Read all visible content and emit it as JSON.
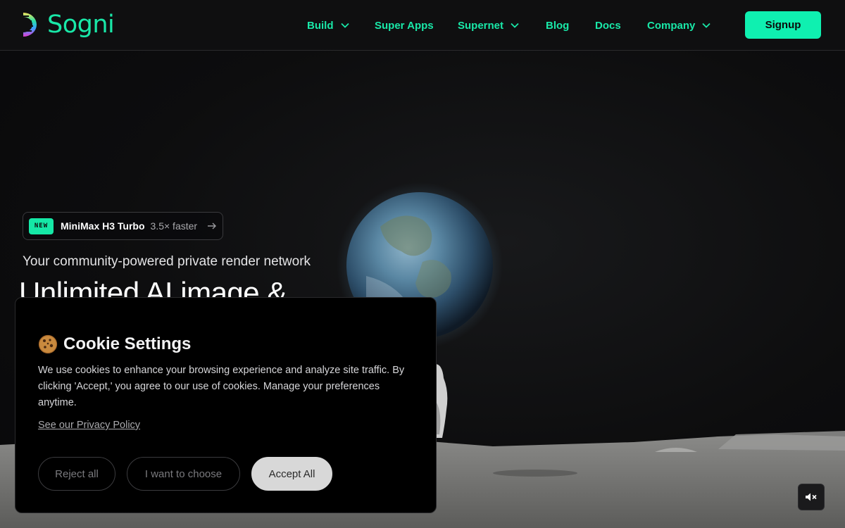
{
  "brand": {
    "name": "Sogni",
    "accent": "#19e8a8"
  },
  "nav": {
    "items": [
      {
        "label": "Build",
        "has_dropdown": true
      },
      {
        "label": "Super Apps",
        "has_dropdown": false
      },
      {
        "label": "Supernet",
        "has_dropdown": true
      },
      {
        "label": "Blog",
        "has_dropdown": false
      },
      {
        "label": "Docs",
        "has_dropdown": false
      },
      {
        "label": "Company",
        "has_dropdown": true
      }
    ],
    "signup_label": "Signup"
  },
  "hero": {
    "badge": {
      "tag": "NEW",
      "title": "MiniMax H3 Turbo",
      "subtitle": "3.5× faster",
      "icon": "arrow-right-icon"
    },
    "tagline": "Your community-powered private render network",
    "headline": "Unlimited AI image &",
    "mute_icon": "speaker-muted-icon"
  },
  "cookie": {
    "icon": "cookie-icon",
    "title": "Cookie Settings",
    "body": "We use cookies to enhance your browsing experience and analyze site traffic. By clicking 'Accept,' you agree to our use of cookies. Manage your preferences anytime.",
    "privacy_link": "See our Privacy Policy",
    "reject_label": "Reject all",
    "choose_label": "I want to choose",
    "accept_label": "Accept All"
  }
}
